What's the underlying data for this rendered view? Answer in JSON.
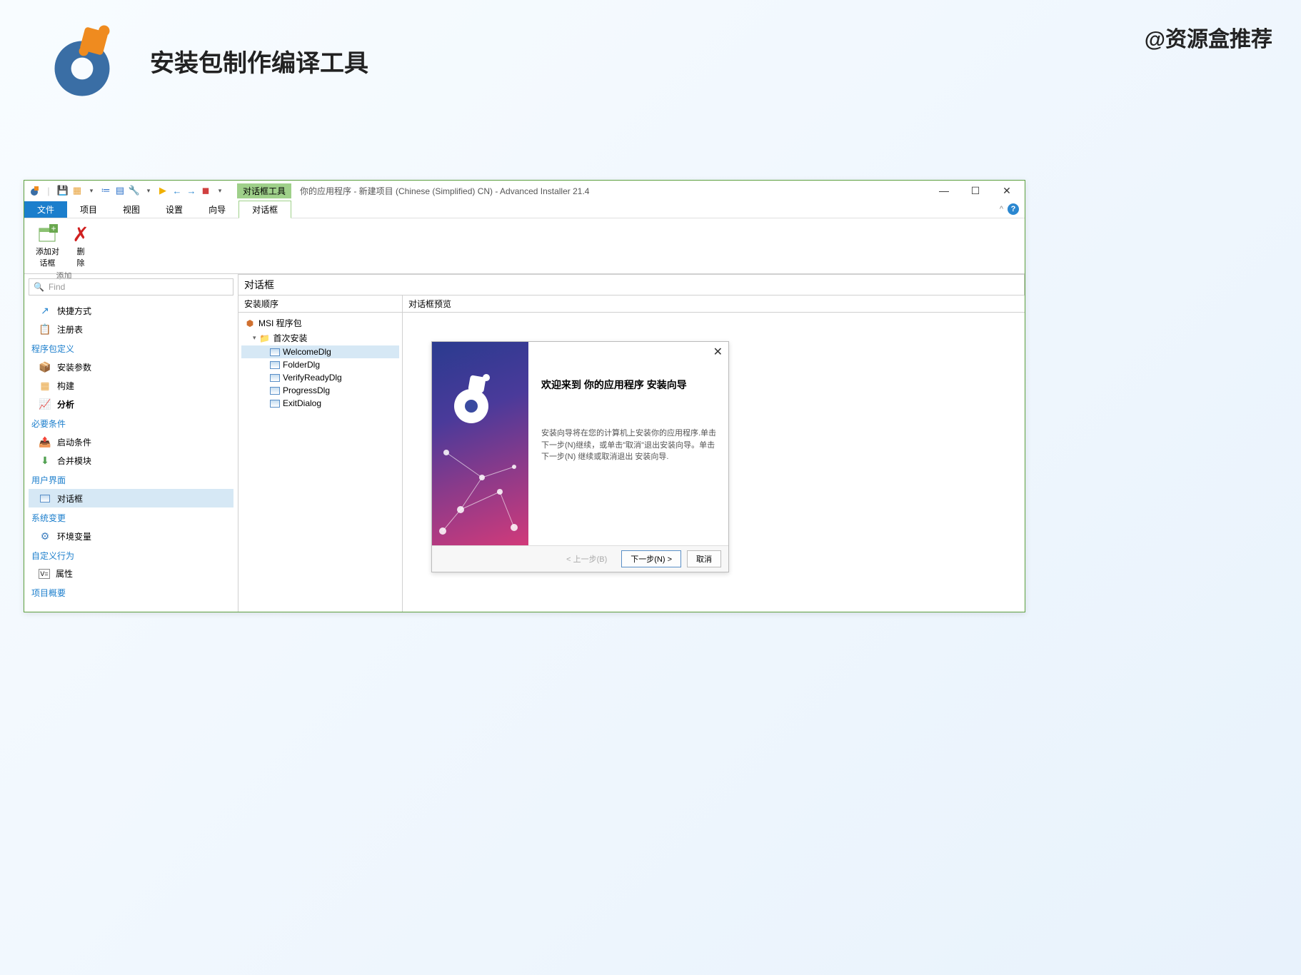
{
  "watermark": "@资源盒推荐",
  "page_title": "安装包制作编译工具",
  "titlebar": {
    "context_tab": "对话框工具",
    "title": "你的应用程序 - 新建项目 (Chinese (Simplified) CN) - Advanced Installer 21.4"
  },
  "menubar": {
    "file": "文件",
    "items": [
      "项目",
      "视图",
      "设置",
      "向导"
    ],
    "active": "对话框"
  },
  "ribbon": {
    "add_dialog": "添加对\n话框",
    "delete": "删\n除",
    "group_add": "添加"
  },
  "search": {
    "placeholder": "Find"
  },
  "nav": {
    "section1": [
      {
        "icon": "shortcut",
        "label": "快捷方式"
      },
      {
        "icon": "registry",
        "label": "注册表"
      }
    ],
    "header1": "程序包定义",
    "section2": [
      {
        "icon": "params",
        "label": "安装参数"
      },
      {
        "icon": "build",
        "label": "构建"
      },
      {
        "icon": "analyze",
        "label": "分析",
        "bold": true
      }
    ],
    "header2": "必要条件",
    "section3": [
      {
        "icon": "launch",
        "label": "启动条件"
      },
      {
        "icon": "merge",
        "label": "合并模块"
      }
    ],
    "header3": "用户界面",
    "section4": [
      {
        "icon": "dialog",
        "label": "对话框",
        "selected": true
      }
    ],
    "header4": "系统变更",
    "section5": [
      {
        "icon": "env",
        "label": "环境变量"
      }
    ],
    "header5": "自定义行为",
    "section6": [
      {
        "icon": "prop",
        "label": "属性"
      }
    ],
    "header6": "项目概要"
  },
  "center": {
    "panel_header": "对话框",
    "tree_header": "安装顺序",
    "preview_header": "对话框预览",
    "tree": {
      "root": "MSI 程序包",
      "folder": "首次安装",
      "items": [
        "WelcomeDlg",
        "FolderDlg",
        "VerifyReadyDlg",
        "ProgressDlg",
        "ExitDialog"
      ],
      "selected": "WelcomeDlg"
    }
  },
  "wizard": {
    "title": "欢迎来到 你的应用程序 安装向导",
    "body": "安装向导将在您的计算机上安装你的应用程序.单击下一步(N)继续，或单击\"取消\"退出安装向导。单击 下一步(N) 继续或取消退出 安装向导.",
    "back": "< 上一步(B)",
    "next": "下一步(N) >",
    "cancel": "取消"
  }
}
